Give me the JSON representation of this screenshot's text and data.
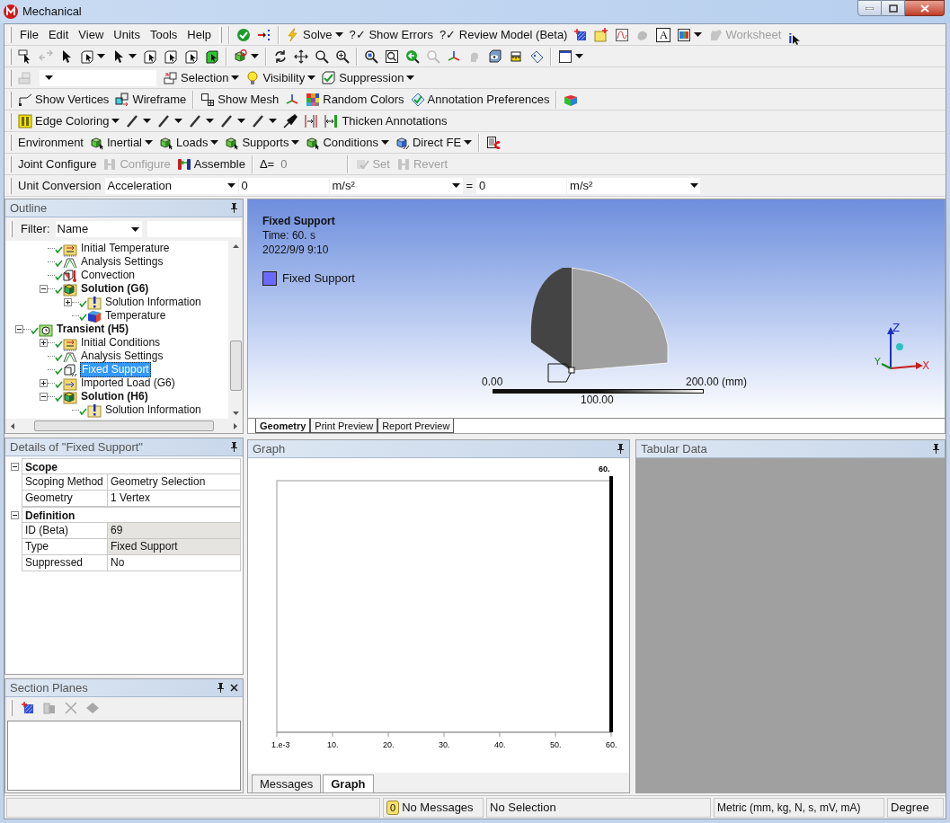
{
  "window": {
    "title": "Mechanical"
  },
  "menu": [
    "File",
    "Edit",
    "View",
    "Units",
    "Tools",
    "Help"
  ],
  "toolbars": [
    {
      "groups": [
        [
          {
            "kind": "icon",
            "disabled": false
          },
          {
            "kind": "icon",
            "disabled": false
          }
        ],
        [
          {
            "kind": "button",
            "label": "Solve",
            "dropdown": true,
            "disabled": false
          },
          {
            "kind": "text",
            "glyph": "?✓",
            "label": "Show Errors",
            "disabled": false
          },
          {
            "kind": "text",
            "glyph": "?✓",
            "label": "Review Model (Beta)",
            "disabled": false
          },
          {
            "kind": "icon",
            "disabled": false
          },
          {
            "kind": "icon",
            "disabled": false
          },
          {
            "kind": "icon",
            "disabled": false
          },
          {
            "kind": "icon",
            "disabled": true
          },
          {
            "kind": "letter",
            "glyph": "A",
            "disabled": false
          },
          {
            "kind": "icon",
            "dropdown": true,
            "disabled": false
          },
          {
            "kind": "button",
            "label": "Worksheet",
            "disabled": true
          },
          {
            "kind": "info",
            "glyph": "i",
            "disabled": false
          }
        ]
      ]
    },
    {
      "groups": [
        [
          {
            "kind": "icon",
            "disabled": false
          },
          {
            "kind": "icon",
            "disabled": true
          },
          {
            "kind": "icon",
            "disabled": false
          },
          {
            "kind": "icon",
            "dropdown": true,
            "disabled": false
          },
          {
            "kind": "icon",
            "dropdown": true,
            "disabled": false
          },
          {
            "kind": "icon",
            "disabled": false
          },
          {
            "kind": "icon",
            "disabled": false
          },
          {
            "kind": "icon",
            "disabled": false
          },
          {
            "kind": "icon",
            "disabled": false
          }
        ],
        [
          {
            "kind": "icon",
            "dropdown": true,
            "disabled": false
          }
        ],
        [
          {
            "kind": "icon",
            "disabled": false
          },
          {
            "kind": "icon",
            "disabled": false
          },
          {
            "kind": "icon",
            "disabled": false
          },
          {
            "kind": "icon",
            "disabled": false
          }
        ],
        [
          {
            "kind": "icon",
            "disabled": false
          },
          {
            "kind": "icon",
            "disabled": false
          },
          {
            "kind": "icon",
            "disabled": false
          },
          {
            "kind": "icon",
            "disabled": true
          },
          {
            "kind": "icon",
            "disabled": false
          },
          {
            "kind": "icon",
            "disabled": true
          },
          {
            "kind": "icon",
            "disabled": false
          },
          {
            "kind": "icon",
            "disabled": false
          },
          {
            "kind": "icon",
            "disabled": false
          }
        ],
        [
          {
            "kind": "icon",
            "dropdown": true,
            "disabled": false
          }
        ]
      ]
    },
    {
      "groups": [
        [
          {
            "kind": "icon",
            "disabled": true
          },
          {
            "kind": "select",
            "disabled": false
          },
          {
            "kind": "button",
            "label": "Selection",
            "dropdown": true,
            "disabled": false
          },
          {
            "kind": "button",
            "label": "Visibility",
            "dropdown": true,
            "disabled": false
          },
          {
            "kind": "button",
            "label": "Suppression",
            "dropdown": true,
            "disabled": false
          }
        ]
      ]
    },
    {
      "groups": [
        [
          {
            "kind": "button",
            "label": "Show Vertices",
            "disabled": false
          },
          {
            "kind": "button",
            "label": "Wireframe",
            "disabled": false
          }
        ],
        [
          {
            "kind": "button",
            "label": "Show Mesh",
            "disabled": false
          },
          {
            "kind": "icon",
            "disabled": false
          },
          {
            "kind": "button",
            "label": "Random Colors",
            "disabled": false
          },
          {
            "kind": "button",
            "label": "Annotation Preferences",
            "disabled": false
          }
        ],
        [
          {
            "kind": "icon",
            "disabled": false
          }
        ]
      ]
    },
    {
      "groups": [
        [
          {
            "kind": "button",
            "label": "Edge Coloring",
            "dropdown": true,
            "disabled": false
          },
          {
            "kind": "icon",
            "dropdown": true,
            "disabled": false
          },
          {
            "kind": "icon",
            "dropdown": true,
            "disabled": false
          },
          {
            "kind": "icon",
            "dropdown": true,
            "disabled": false
          },
          {
            "kind": "icon",
            "dropdown": true,
            "disabled": false
          },
          {
            "kind": "icon",
            "dropdown": true,
            "disabled": false
          },
          {
            "kind": "icon",
            "disabled": false
          },
          {
            "kind": "icon",
            "disabled": false
          },
          {
            "kind": "button",
            "label": "Thicken Annotations",
            "disabled": false
          }
        ]
      ]
    },
    {
      "groups": [
        [
          {
            "kind": "label",
            "label": "Environment"
          },
          {
            "kind": "button",
            "label": "Inertial",
            "dropdown": true,
            "disabled": false
          },
          {
            "kind": "button",
            "label": "Loads",
            "dropdown": true,
            "disabled": false
          },
          {
            "kind": "button",
            "label": "Supports",
            "dropdown": true,
            "disabled": false
          },
          {
            "kind": "button",
            "label": "Conditions",
            "dropdown": true,
            "disabled": false
          },
          {
            "kind": "button",
            "label": "Direct FE",
            "dropdown": true,
            "disabled": false
          }
        ],
        [
          {
            "kind": "icon",
            "disabled": false
          }
        ]
      ]
    },
    {
      "groups": [
        [
          {
            "kind": "label",
            "label": "Joint Configure"
          },
          {
            "kind": "button",
            "label": "Configure",
            "disabled": true
          },
          {
            "kind": "button",
            "label": "Assemble",
            "disabled": false
          }
        ],
        [
          {
            "kind": "label",
            "label": "Δ="
          },
          {
            "kind": "value",
            "label": "0"
          }
        ],
        [
          {
            "kind": "button",
            "label": "Set",
            "disabled": true
          },
          {
            "kind": "button",
            "label": "Revert",
            "disabled": true
          }
        ]
      ]
    },
    {
      "groups": [
        [
          {
            "kind": "label",
            "label": "Unit Conversion"
          },
          {
            "kind": "select",
            "value": "Acceleration",
            "disabled": false
          },
          {
            "kind": "field",
            "value": "0",
            "disabled": false
          },
          {
            "kind": "select",
            "value": "m/s²",
            "disabled": false
          },
          {
            "kind": "label",
            "label": "="
          },
          {
            "kind": "field",
            "value": "0",
            "disabled": false
          },
          {
            "kind": "select",
            "value": "m/s²",
            "disabled": false
          }
        ]
      ]
    }
  ],
  "outline": {
    "title": "Outline",
    "filter_label": "Filter:",
    "filter": "Name",
    "tree": [
      {
        "children": [
          {
            "label": "Initial Temperature",
            "kind": "initial",
            "done": true,
            "selected": false
          },
          {
            "label": "Analysis Settings",
            "kind": "settings",
            "done": true,
            "selected": false
          },
          {
            "label": "Convection",
            "kind": "convection",
            "done": true,
            "selected": false
          },
          {
            "label": "Solution (G6)",
            "kind": "solution",
            "done": true,
            "selected": false,
            "expanded": true,
            "children": [
              {
                "label": "Solution Information",
                "kind": "info",
                "done": true,
                "selected": false,
                "expanded": false
              },
              {
                "label": "Temperature",
                "kind": "result",
                "done": true,
                "selected": false
              }
            ]
          }
        ]
      },
      {
        "label": "Transient (H5)",
        "kind": "analysis",
        "done": true,
        "selected": false,
        "expanded": true,
        "children": [
          {
            "label": "Initial Conditions",
            "kind": "initial",
            "done": true,
            "selected": false,
            "expanded": false
          },
          {
            "label": "Analysis Settings",
            "kind": "settings",
            "done": true,
            "selected": false
          },
          {
            "label": "Fixed Support",
            "kind": "support",
            "done": true,
            "selected": true
          },
          {
            "label": "Imported Load (G6)",
            "kind": "imported",
            "done": true,
            "selected": false,
            "expanded": false
          },
          {
            "label": "Solution (H6)",
            "kind": "solution",
            "done": true,
            "selected": false,
            "expanded": true,
            "children": [
              {
                "label": "Solution Information",
                "kind": "info",
                "done": true,
                "selected": false
              }
            ]
          }
        ]
      }
    ]
  },
  "details": {
    "title": "Details of \"Fixed Support\"",
    "groups": [
      {
        "label": "Scope",
        "expanded": true,
        "rows": [
          {
            "name": "Scoping Method",
            "value": "Geometry Selection",
            "readonly": false
          },
          {
            "name": "Geometry",
            "value": "1 Vertex",
            "readonly": false
          }
        ]
      },
      {
        "label": "Definition",
        "expanded": true,
        "rows": [
          {
            "name": "ID (Beta)",
            "value": "69",
            "readonly": true
          },
          {
            "name": "Type",
            "value": "Fixed Support",
            "readonly": true
          },
          {
            "name": "Suppressed",
            "value": "No",
            "readonly": false
          }
        ]
      }
    ]
  },
  "section_planes": {
    "title": "Section Planes",
    "tools": [
      {
        "disabled": false
      },
      {
        "disabled": true
      },
      {
        "disabled": true
      },
      {
        "disabled": true
      }
    ]
  },
  "viewport": {
    "title": "Fixed Support",
    "lines": [
      "Time: 60. s",
      "2022/9/9 9:10"
    ],
    "legend": [
      {
        "label": "Fixed Support",
        "color": "#6a6afa"
      }
    ],
    "scale": {
      "start": "0.00",
      "end": "200.00 (mm)",
      "middle": "100.00"
    },
    "triad": {
      "x": "X",
      "y": "Y",
      "z": "Z"
    },
    "tabs": [
      {
        "label": "Geometry",
        "selected": true
      },
      {
        "label": "Print Preview",
        "selected": false
      },
      {
        "label": "Report Preview",
        "selected": false
      }
    ]
  },
  "graph": {
    "title": "Graph",
    "axis_labels": [
      "1.e-3",
      "10.",
      "20.",
      "30.",
      "40.",
      "50.",
      "60."
    ],
    "marker_label": "60.",
    "tabs": [
      {
        "label": "Messages",
        "selected": false
      },
      {
        "label": "Graph",
        "selected": true
      }
    ]
  },
  "tabular": {
    "title": "Tabular Data"
  },
  "status_bar": {
    "messages_count": "0",
    "messages": "No Messages",
    "selection": "No Selection",
    "units": "Metric (mm, kg, N, s, mV, mA)",
    "angle": "Degree"
  }
}
